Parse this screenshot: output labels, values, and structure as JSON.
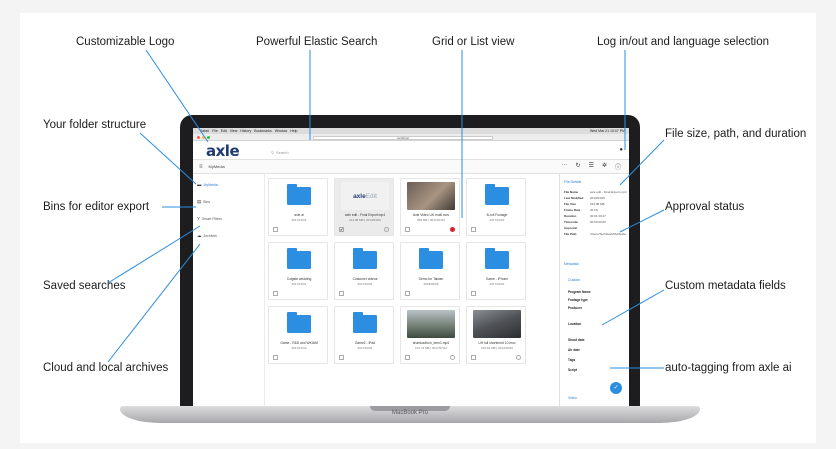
{
  "callouts": {
    "logo": "Customizable Logo",
    "search": "Powerful Elastic Search",
    "grid": "Grid or List view",
    "login": "Log in/out and language selection",
    "folders": "Your folder structure",
    "filesize": "File size, path, and duration",
    "bins": "Bins for editor export",
    "approval": "Approval status",
    "saved": "Saved searches",
    "custom": "Custom metadata fields",
    "archives": "Cloud and local archives",
    "autotag": "auto-tagging from axle ai"
  },
  "laptop_label": "MacBook Pro",
  "menubar": {
    "apple": "",
    "items": [
      "Safari",
      "File",
      "Edit",
      "View",
      "History",
      "Bookmarks",
      "Window",
      "Help"
    ],
    "right": "Wed Mar 21 10:07 PM"
  },
  "browser": {
    "url": "localhost"
  },
  "app": {
    "logo": "axle",
    "search_placeholder": "Search",
    "breadcrumb": "MyMedia"
  },
  "sidebar": {
    "items": [
      {
        "label": "MyMedia",
        "icon": "folder-icon"
      },
      {
        "label": "Bins",
        "icon": "bin-icon"
      },
      {
        "label": "Smart Filters",
        "icon": "filter-icon"
      },
      {
        "label": "Archives",
        "icon": "archive-icon"
      }
    ]
  },
  "grid": {
    "cards": [
      {
        "kind": "folder",
        "title": "axle ai",
        "meta": "2017/10/01"
      },
      {
        "kind": "edit",
        "title": "axle edit - Final Export.mp4",
        "meta": "223.08 MB | 2013/04/02",
        "checked": "✔"
      },
      {
        "kind": "photo",
        "title": "Axle Video UK multi.mov",
        "meta": "883 MB | 2017/01/03",
        "dot_color": "#d8232a",
        "photo_color": "#6a5d55"
      },
      {
        "kind": "folder",
        "title": "B-roll Footage",
        "meta": "2017/10/01"
      },
      {
        "kind": "folder",
        "title": "Colgate wedding",
        "meta": "2017/10/01"
      },
      {
        "kind": "folder",
        "title": "Customer videos",
        "meta": "2017/10/01"
      },
      {
        "kind": "folder",
        "title": "Demo for Taiwan",
        "meta": "2018/03/06"
      },
      {
        "kind": "folder",
        "title": "Game - iPhone",
        "meta": "2017/10/01"
      },
      {
        "kind": "folder",
        "title": "Game - R&D and WKIAM",
        "meta": "2017/10/12"
      },
      {
        "kind": "folder",
        "title": "Game2 - iPad",
        "meta": "2017/10/01"
      },
      {
        "kind": "photo",
        "title": "shankouthon_teen1.mp4",
        "meta": "123.72 MB | 2017/07/22",
        "photo_color": "#7c8a7a"
      },
      {
        "kind": "photo",
        "title": "UH full shortened 10.mov",
        "meta": "193.64 MB | 2013/10/03",
        "photo_color": "#5d6168"
      }
    ]
  },
  "panel": {
    "file_details": "File Details",
    "rows": [
      {
        "k": "File Name",
        "v": "axle edit - Final Export.mp4"
      },
      {
        "k": "Last Modified",
        "v": "2013/04/02"
      },
      {
        "k": "File Size",
        "v": "223.08 MB"
      },
      {
        "k": "Frame Rate",
        "v": "30 FS"
      },
      {
        "k": "Duration",
        "v": "00:01:39:27"
      },
      {
        "k": "Timecode",
        "v": "00:00:00:00"
      },
      {
        "k": "Approval",
        "v": ""
      },
      {
        "k": "File Path",
        "v": "/Users/TechDesk/MyMedia"
      }
    ],
    "metadata": "Metadata",
    "custom": "Custom",
    "fields": [
      "Program Name",
      "Footage type",
      "Producer",
      "Location",
      "Shoot date",
      "Air date",
      "Tags",
      "Script"
    ],
    "video": "Video"
  },
  "colors": {
    "accent": "#2b8ee0",
    "logo": "#1f3b6f",
    "approval_red": "#d8232a"
  }
}
